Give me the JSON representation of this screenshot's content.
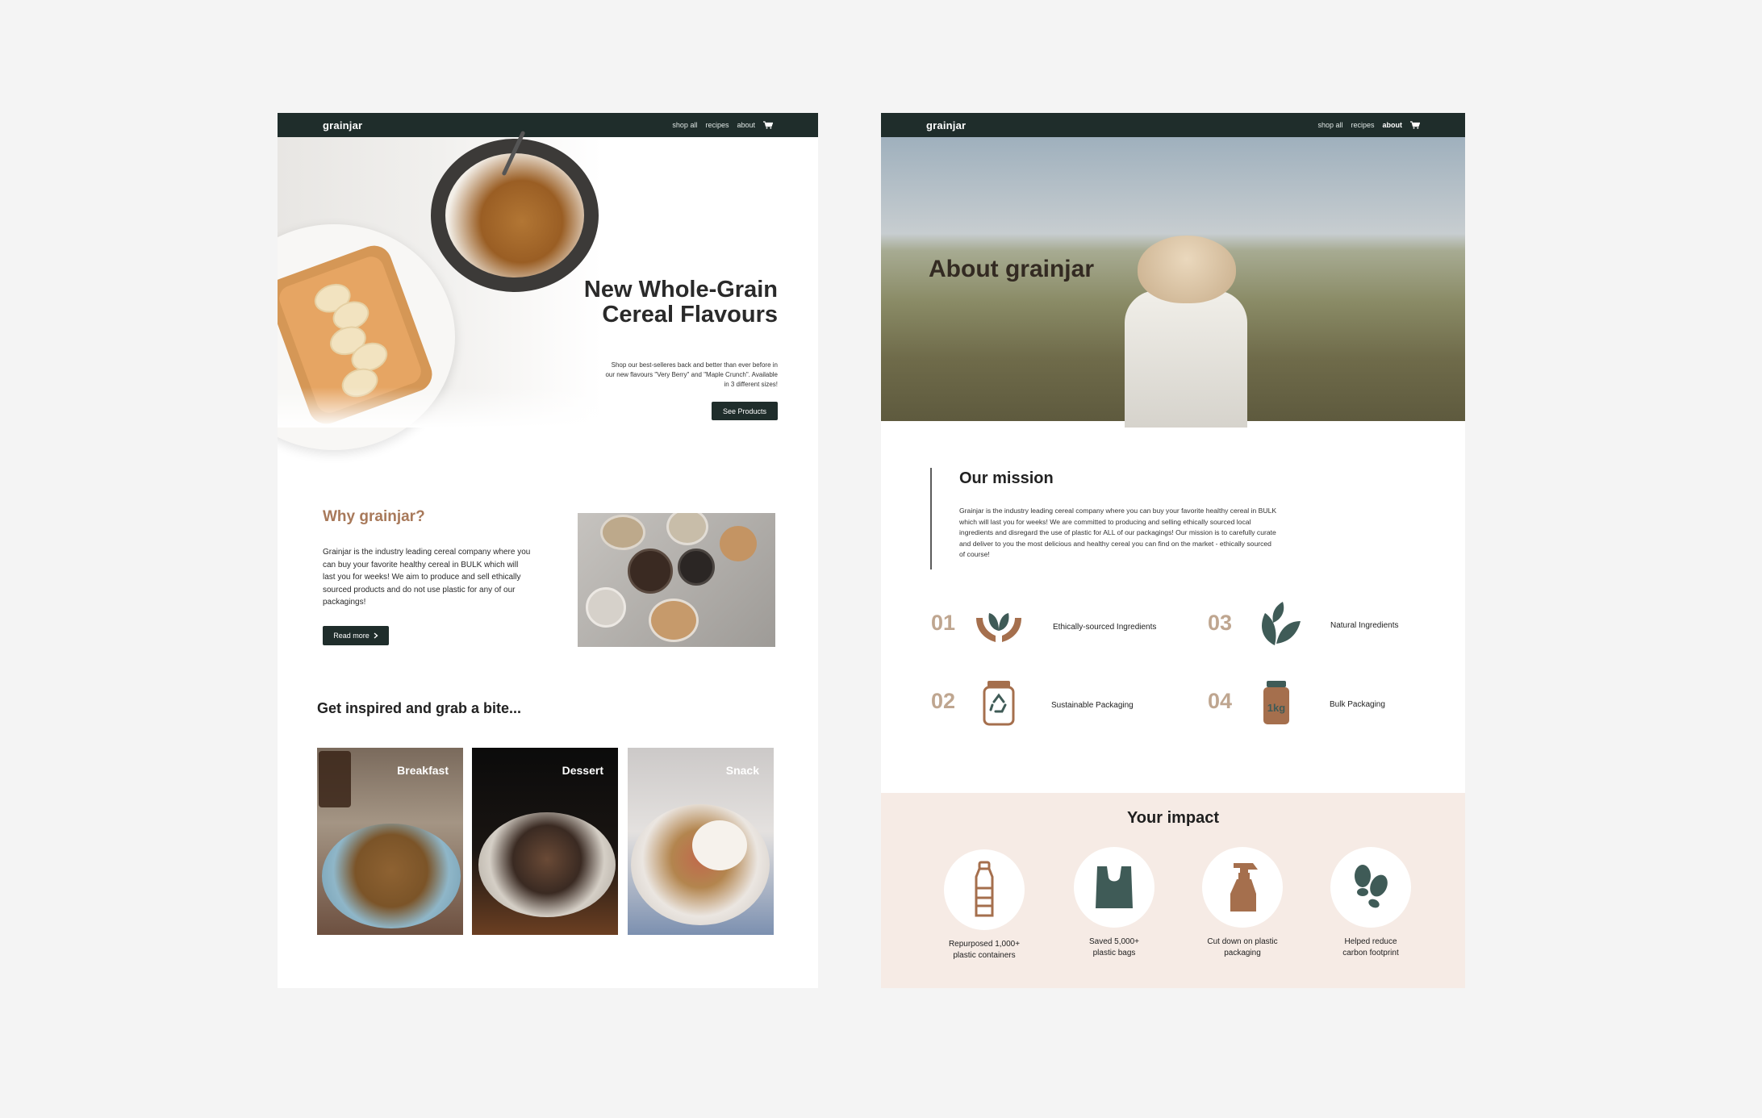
{
  "colors": {
    "background": "#f4f4f4",
    "nav": "#1f2d2b",
    "accent_brown": "#a8795a",
    "number_tan": "#bfa690",
    "impact_bg": "#f6ebe5",
    "icon_teal": "#3f5b57",
    "icon_brown": "#a56f4d"
  },
  "home": {
    "nav": {
      "logo": "grainjar",
      "links": [
        "shop all",
        "recipes",
        "about"
      ],
      "cart_icon": "shopping-cart-icon"
    },
    "hero": {
      "title_line1": "New Whole-Grain",
      "title_line2": "Cereal Flavours",
      "subtitle": "Shop our best-selleres back and better than ever before in our new flavours \"Very Berry\" and \"Maple Crunch\". Available in 3 different sizes!",
      "button": "See Products"
    },
    "why": {
      "title": "Why grainjar?",
      "body": "Grainjar is the industry leading cereal company where you can buy your favorite healthy cereal in BULK which will last you for weeks! We aim to produce and sell ethically sourced products and do not use plastic for any of our packagings!",
      "button": "Read more",
      "button_icon": "chevron-right-icon"
    },
    "inspired": {
      "title": "Get inspired and grab a bite...",
      "cards": [
        {
          "label": "Breakfast"
        },
        {
          "label": "Dessert"
        },
        {
          "label": "Snack"
        }
      ]
    }
  },
  "about": {
    "nav": {
      "logo": "grainjar",
      "links": [
        "shop all",
        "recipes",
        "about"
      ],
      "active": "about",
      "cart_icon": "shopping-cart-icon"
    },
    "hero": {
      "title": "About grainjar"
    },
    "mission": {
      "title": "Our mission",
      "body": "Grainjar is the industry leading cereal company where you can buy your favorite healthy cereal in BULK which will last you for weeks! We are committed to producing and selling ethically sourced local ingredients and disregard the use of plastic for ALL of our packagings! Our mission is to carefully curate and deliver to you the most delicious and healthy cereal you can find on the market - ethically sourced of course!"
    },
    "features": [
      {
        "number": "01",
        "label": "Ethically-sourced Ingredients",
        "icon": "hands-leaf-icon"
      },
      {
        "number": "03",
        "label": "Natural Ingredients",
        "icon": "leaves-icon"
      },
      {
        "number": "02",
        "label": "Sustainable Packaging",
        "icon": "recycle-jar-icon"
      },
      {
        "number": "04",
        "label": "Bulk Packaging",
        "icon": "bulk-jar-icon",
        "icon_text": "1kg"
      }
    ],
    "impact": {
      "title": "Your impact",
      "items": [
        {
          "label_line1": "Repurposed 1,000+",
          "label_line2": "plastic containers",
          "icon": "plastic-bottle-icon"
        },
        {
          "label_line1": "Saved 5,000+",
          "label_line2": "plastic bags",
          "icon": "plastic-bag-icon"
        },
        {
          "label_line1": "Cut down on plastic",
          "label_line2": "packaging",
          "icon": "spray-bottle-icon"
        },
        {
          "label_line1": "Helped reduce",
          "label_line2": "carbon footprint",
          "icon": "footprints-icon"
        }
      ]
    }
  }
}
